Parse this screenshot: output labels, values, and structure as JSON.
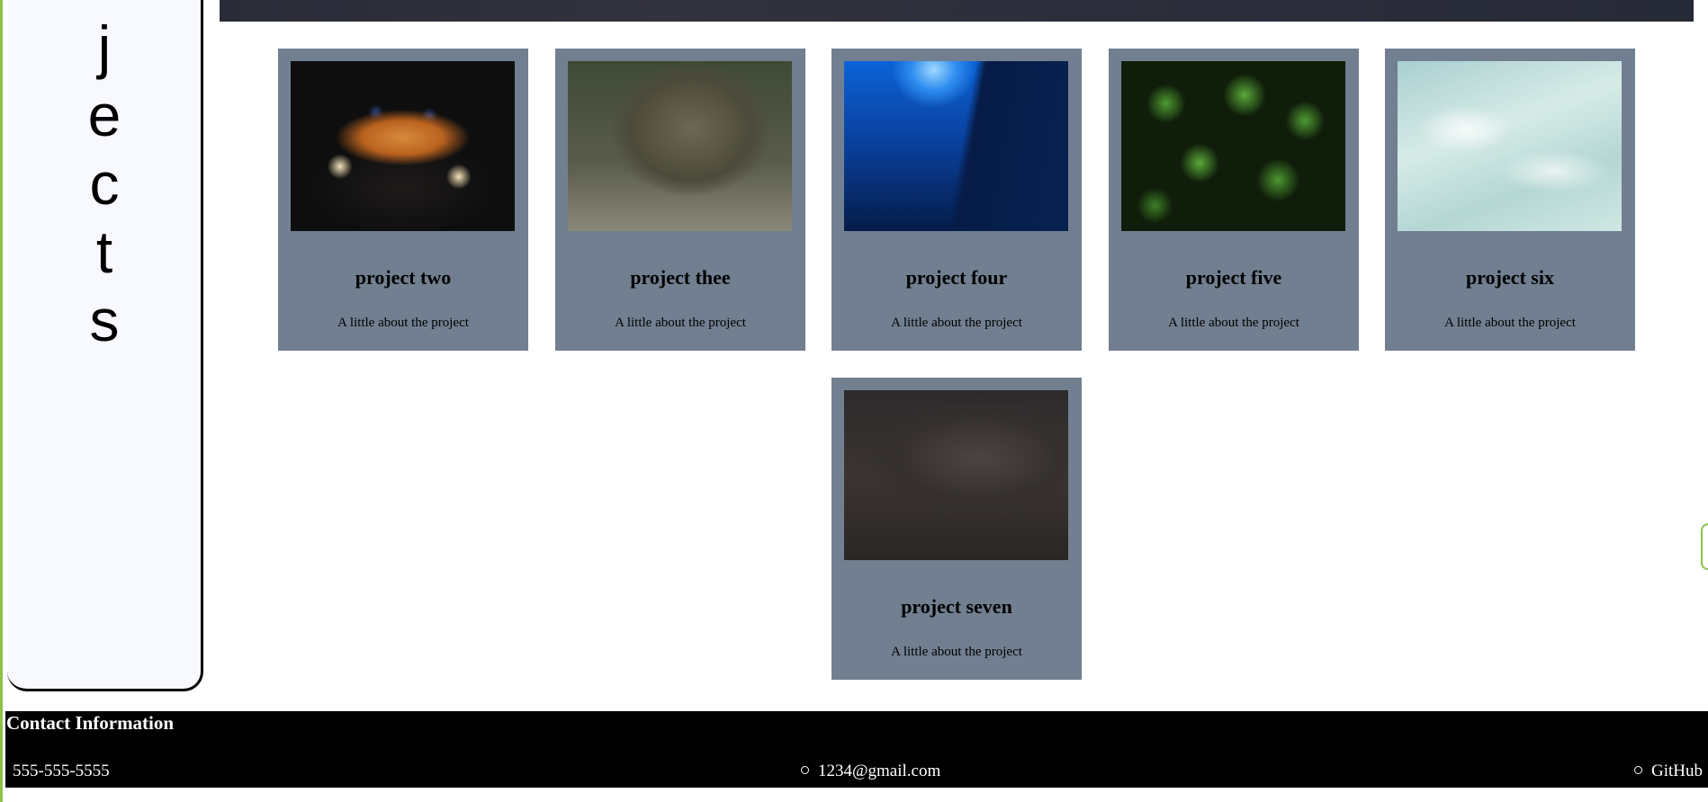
{
  "sidebar": {
    "letters": [
      "j",
      "e",
      "c",
      "t",
      "s"
    ]
  },
  "projects": [
    {
      "title": "project two",
      "description": "A little about the project"
    },
    {
      "title": "project thee",
      "description": "A little about the project"
    },
    {
      "title": "project four",
      "description": "A little about the project"
    },
    {
      "title": "project five",
      "description": "A little about the project"
    },
    {
      "title": "project six",
      "description": "A little about the project"
    },
    {
      "title": "project seven",
      "description": "A little about the project"
    }
  ],
  "footer": {
    "title": "Contact Information",
    "phone": "555-555-5555",
    "email": "1234@gmail.com",
    "github": "GitHub"
  },
  "colors": {
    "card_bg": "#717f91",
    "sidebar_bg": "#f8f9fe",
    "accent_green": "#8bc34a",
    "footer_bg": "#000000"
  }
}
